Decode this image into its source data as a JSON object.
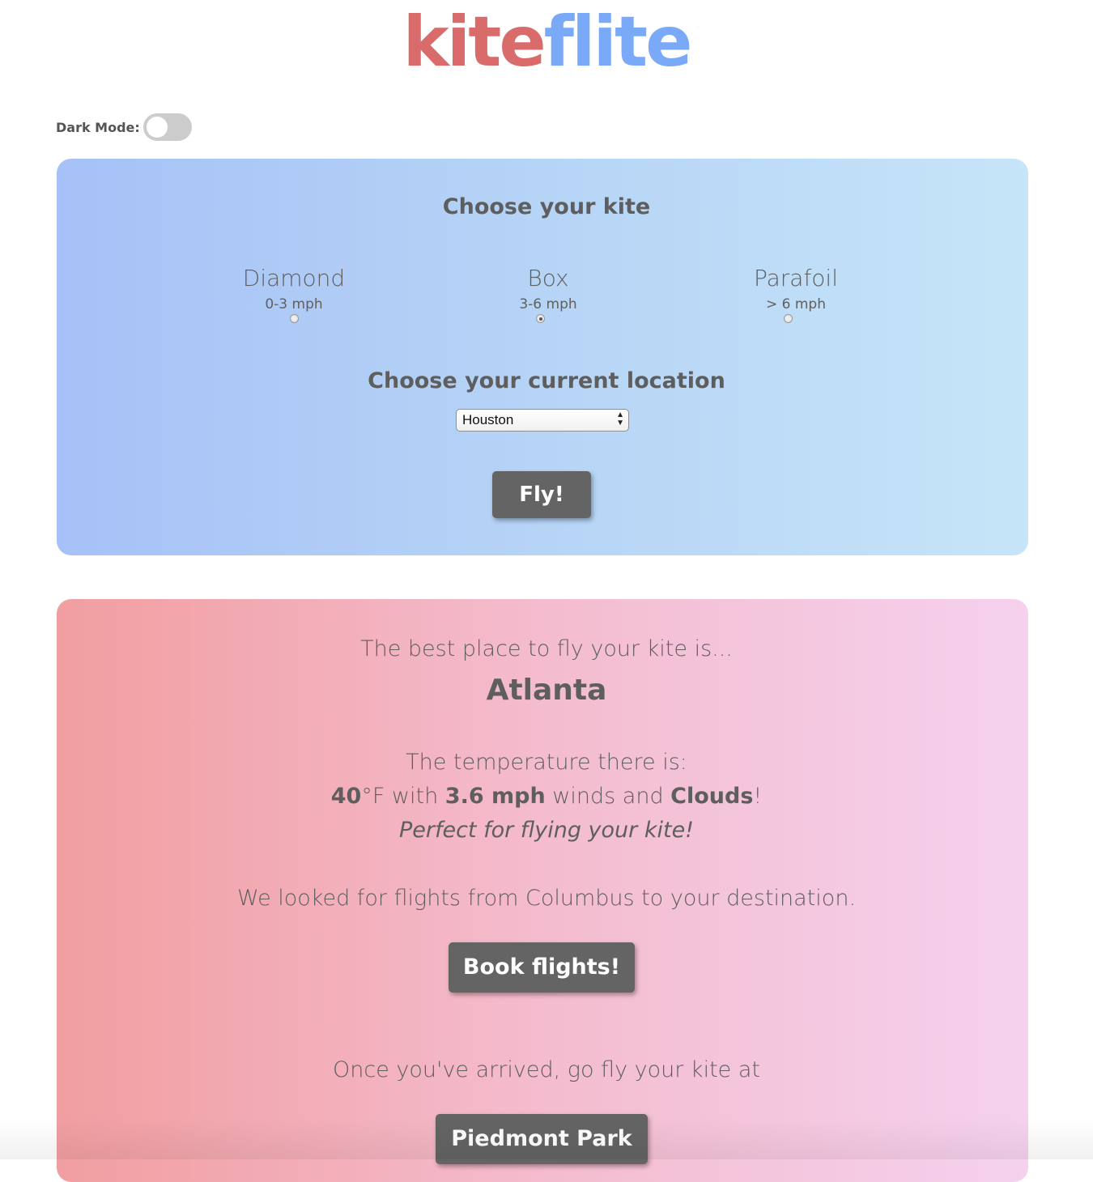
{
  "logo": {
    "part1": "kite",
    "part2": "flite"
  },
  "dark_mode": {
    "label": "Dark Mode:",
    "enabled": false
  },
  "kite_section": {
    "heading": "Choose your kite",
    "options": [
      {
        "name": "Diamond",
        "range": "0-3 mph",
        "selected": false
      },
      {
        "name": "Box",
        "range": "3-6 mph",
        "selected": true
      },
      {
        "name": "Parafoil",
        "range": "> 6 mph",
        "selected": false
      }
    ]
  },
  "location_section": {
    "heading": "Choose your current location",
    "selected_value": "Houston"
  },
  "fly_button": "Fly!",
  "result": {
    "intro": "The best place to fly your kite is...",
    "city": "Atlanta",
    "temp_intro": "The temperature there is:",
    "temperature": "40",
    "temp_unit": "°F with ",
    "wind": "3.6 mph",
    "winds_text": " winds and ",
    "condition": "Clouds",
    "exclaim": "!",
    "verdict": "Perfect for flying your kite!",
    "flights_text": "We looked for flights from Columbus to your destination.",
    "book_button": "Book flights!",
    "arrival_text": "Once you've arrived, go fly your kite at",
    "park_button": "Piedmont Park"
  },
  "colors": {
    "logo_red": "#d96b6b",
    "logo_blue": "#7aaaf7",
    "button_gray": "#646464"
  }
}
